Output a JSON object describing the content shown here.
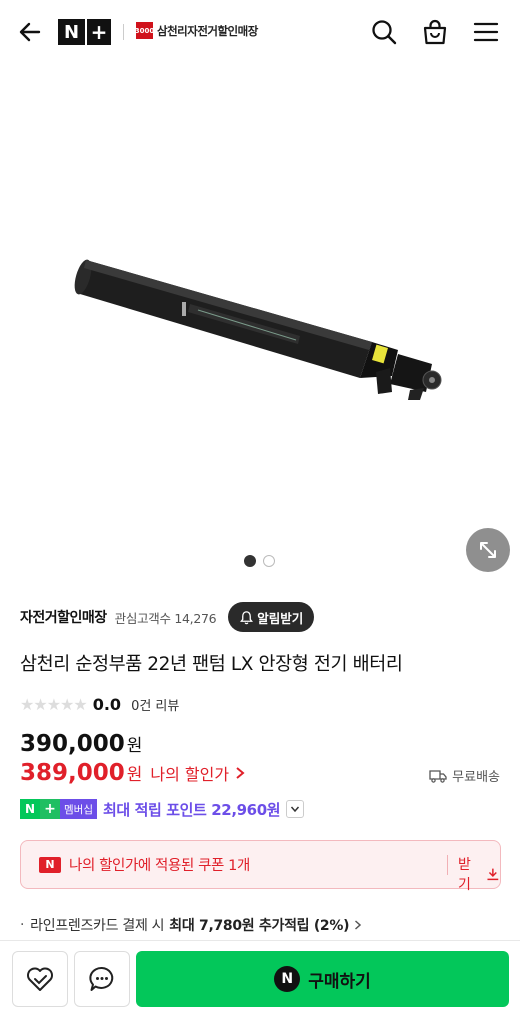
{
  "header": {
    "nplus_n": "N",
    "nplus_plus": "+",
    "store_logo_text": "삼천리자전거할인매장",
    "store_logo_mark": "3000"
  },
  "gallery": {
    "page_count": 2,
    "active_index": 0
  },
  "store": {
    "name": "자전거할인매장",
    "fans_label": "관심고객수 14,276",
    "alarm_label": "알림받기"
  },
  "product": {
    "title": "삼천리 순정부품 22년 팬텀 LX 안장형 전기 배터리"
  },
  "rating": {
    "stars_filled": 0,
    "score": "0.0",
    "reviews": "0건 리뷰"
  },
  "price": {
    "original": "390,000",
    "original_unit": "원",
    "sale": "389,000",
    "sale_unit": "원",
    "sale_label": "나의 할인가",
    "shipping": "무료배송"
  },
  "points": {
    "badge_n": "N",
    "badge_plus": "+",
    "badge_text": "멤버십",
    "text": "최대 적립 포인트 22,960원"
  },
  "coupon": {
    "mark": "N",
    "text": "나의 할인가에 적용된 쿠폰 1개",
    "get_label": "받기"
  },
  "card": {
    "bullet": "·",
    "text": "라인프렌즈카드 결제 시",
    "bold": "최대 7,780원 추가적립 (2%)"
  },
  "bottom": {
    "buy_mark": "N",
    "buy_label": "구매하기"
  },
  "colors": {
    "naver_green": "#03c75a",
    "sale_red": "#e0202a",
    "membership_purple": "#6c4ee8"
  }
}
